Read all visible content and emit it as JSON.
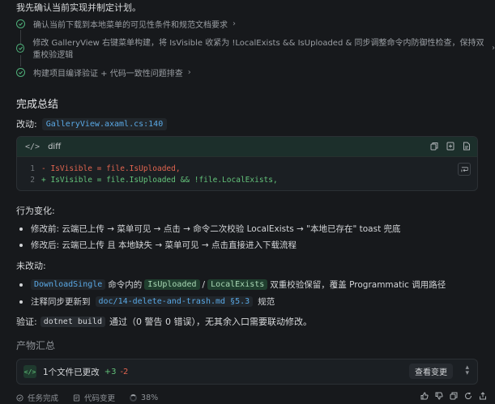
{
  "intro": "我先确认当前实现并制定计划。",
  "steps": [
    {
      "text": "确认当前下载到本地菜单的可见性条件和规范文档要求",
      "chevron": "›"
    },
    {
      "text": "修改 GalleryView 右键菜单构建，将 IsVisible 收紧为 !LocalExists && IsUploaded & 同步调整命令内防御性检查，保持双重校验逻辑",
      "chevron": "›"
    },
    {
      "text": "构建项目编译验证 + 代码一致性问题排查",
      "chevron": "›"
    }
  ],
  "summary_title": "完成总结",
  "modified": {
    "label": "改动:",
    "file": "GalleryView.axaml.cs:140"
  },
  "diff": {
    "lang": "diff",
    "lang_icon": "</>",
    "header_icons": [
      "copy-icon",
      "duplicate-icon",
      "file-icon"
    ],
    "lines": [
      {
        "num": "1",
        "text": "- IsVisible = file.IsUploaded,",
        "kind": "del"
      },
      {
        "num": "2",
        "text": "+ IsVisible = file.IsUploaded && !file.LocalExists,",
        "kind": "add"
      }
    ]
  },
  "behavior_title": "行为变化:",
  "behavior": [
    "修改前: 云端已上传 → 菜单可见 → 点击 → 命令二次校验 LocalExists → \"本地已存在\" toast 兜底",
    "修改后: 云端已上传 且 本地缺失 → 菜单可见 → 点击直接进入下载流程"
  ],
  "unchanged_title": "未改动:",
  "unchanged": {
    "item1": {
      "code1": "DownloadSingle",
      "t1": "命令内的",
      "code2": "IsUploaded",
      "sep": "/",
      "code3": "LocalExists",
      "t2": "双重校验保留，覆盖 Programmatic 调用路径"
    },
    "item2": {
      "t1": "注释同步更新到",
      "code": "doc/14-delete-and-trash.md §5.3",
      "t2": "规范"
    }
  },
  "verify": {
    "label": "验证:",
    "code": "dotnet build",
    "text": "通过（0 警告 0 错误），无其余入口需要联动修改。"
  },
  "products_title": "产物汇总",
  "file_bar": {
    "icon": "</>",
    "count": "1个文件已更改",
    "plus": "+3",
    "minus": "-2",
    "review": "查看变更"
  },
  "status": {
    "done": "任务完成",
    "code_change": "代码变更",
    "progress": "38%"
  },
  "colors": {
    "accent_green": "#63c27a",
    "del_red": "#e0644f",
    "link_blue": "#5aa9e6"
  }
}
